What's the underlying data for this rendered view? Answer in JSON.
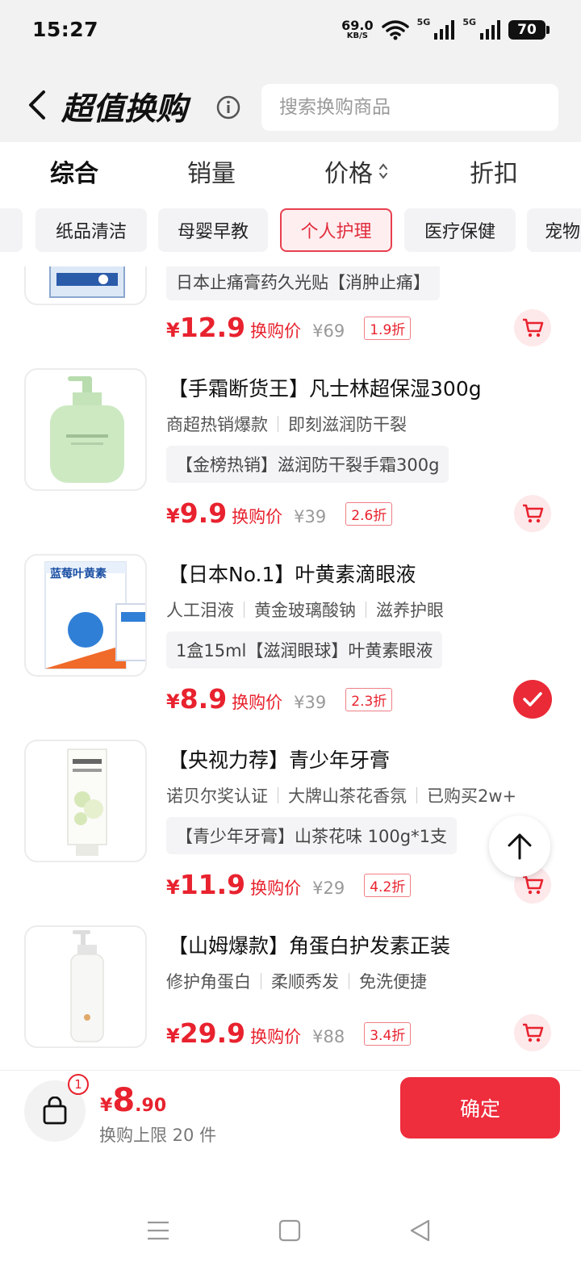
{
  "status_bar": {
    "time": "15:27",
    "net_speed": "69.0",
    "net_unit": "KB/S",
    "sim1": "5G",
    "sim2": "5G",
    "battery": "70"
  },
  "header": {
    "title": "超值换购",
    "search_placeholder": "搜索换购商品"
  },
  "sort_tabs": [
    {
      "label": "综合",
      "active": true
    },
    {
      "label": "销量",
      "active": false
    },
    {
      "label": "价格",
      "active": false
    },
    {
      "label": "折扣",
      "active": false
    }
  ],
  "categories": [
    {
      "label": "纸品清洁",
      "active": false
    },
    {
      "label": "母婴早教",
      "active": false
    },
    {
      "label": "个人护理",
      "active": true
    },
    {
      "label": "医疗保健",
      "active": false
    },
    {
      "label": "宠物",
      "active": false
    }
  ],
  "products": [
    {
      "promo": "日本止痛膏药久光贴【消肿止痛】",
      "currency": "¥",
      "price": "12.9",
      "price_label": "换购价",
      "original": "¥69",
      "discount": "1.9折",
      "selected": false
    },
    {
      "name": "【手霜断货王】凡士林超保湿300g",
      "tags": [
        "商超热销爆款",
        "即刻滋润防干裂"
      ],
      "promo": "【金榜热销】滋润防干裂手霜300g",
      "currency": "¥",
      "price": "9.9",
      "price_label": "换购价",
      "original": "¥39",
      "discount": "2.6折",
      "selected": false
    },
    {
      "name": "【日本No.1】叶黄素滴眼液",
      "tags": [
        "人工泪液",
        "黄金玻璃酸钠",
        "滋养护眼"
      ],
      "promo": "1盒15ml【滋润眼球】叶黄素眼液",
      "box_label": "蓝莓叶黄素",
      "currency": "¥",
      "price": "8.9",
      "price_label": "换购价",
      "original": "¥39",
      "discount": "2.3折",
      "selected": true
    },
    {
      "name": "【央视力荐】青少年牙膏",
      "tags": [
        "诺贝尔奖认证",
        "大牌山茶花香氛",
        "已购买2w+"
      ],
      "promo": "【青少年牙膏】山茶花味 100g*1支",
      "currency": "¥",
      "price": "11.9",
      "price_label": "换购价",
      "original": "¥29",
      "discount": "4.2折",
      "selected": false
    },
    {
      "name": "【山姆爆款】角蛋白护发素正装",
      "tags": [
        "修护角蛋白",
        "柔顺秀发",
        "免洗便捷"
      ],
      "currency": "¥",
      "price": "29.9",
      "price_label": "换购价",
      "original": "¥88",
      "discount": "3.4折",
      "selected": false
    }
  ],
  "bottom_bar": {
    "badge_count": "1",
    "currency": "¥",
    "total_int": "8",
    "total_dec": ".90",
    "limit_text": "换购上限 20 件",
    "confirm_label": "确定"
  },
  "colors": {
    "accent": "#e8222e",
    "chip_active_bg": "#ffeef0",
    "header_bg": "#f2f2f2"
  }
}
